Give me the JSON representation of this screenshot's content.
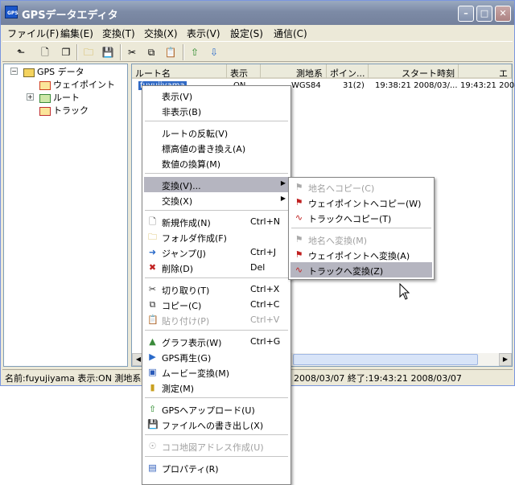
{
  "window": {
    "title": "GPSデータエディタ",
    "icon_text": "GPS"
  },
  "title_buttons": [
    "minimize-icon",
    "maximize-icon",
    "close-icon"
  ],
  "menubar": [
    "ファイル(F)",
    "編集(E)",
    "変換(T)",
    "交換(X)",
    "表示(V)",
    "設定(S)",
    "通信(C)"
  ],
  "toolbar": [
    "up-folder-icon",
    "new-file-icon",
    "copy-file-icon",
    "open-folder-icon",
    "save-icon",
    "cut-icon",
    "copy-icon",
    "paste-icon",
    "upload-icon",
    "download-icon"
  ],
  "tree": {
    "root": "GPS データ",
    "items": [
      "ウェイポイント",
      "ルート",
      "トラック"
    ],
    "colors": {
      "waypoint": "#d04020",
      "route": "#3a8a3a",
      "track": "#c03030",
      "folder": "#f4d35e"
    }
  },
  "list": {
    "columns": [
      "ルート名",
      "表示",
      "測地系",
      "ポイン...",
      "スタート時刻",
      "エ"
    ],
    "row": {
      "name": "fuyujiyama",
      "display": "ON",
      "datum": "WGS84",
      "points": "31(2)",
      "start": "19:38:21 2008/03/...",
      "end": "19:43:21 2008/03/"
    }
  },
  "status": {
    "left": "名前:fuyujiyama 表示:ON 測地系:W",
    "right": "2008/03/07 終了:19:43:21 2008/03/07"
  },
  "context_menu": {
    "items": [
      {
        "label": "表示(V)"
      },
      {
        "label": "非表示(B)"
      },
      {
        "sep": true
      },
      {
        "label": "ルートの反転(V)"
      },
      {
        "label": "標高値の書き換え(A)"
      },
      {
        "label": "数値の換算(M)"
      },
      {
        "sep": true
      },
      {
        "label": "変換(V)...",
        "submenu": true,
        "highlighted": true
      },
      {
        "label": "交換(X)",
        "submenu": true
      },
      {
        "sep": true
      },
      {
        "label": "新規作成(N)",
        "shortcut": "Ctrl+N",
        "icon": "new-file-icon"
      },
      {
        "label": "フォルダ作成(F)",
        "icon": "folder-icon"
      },
      {
        "label": "ジャンプ(J)",
        "shortcut": "Ctrl+J",
        "icon": "jump-icon"
      },
      {
        "label": "削除(D)",
        "shortcut": "Del",
        "icon": "delete-icon"
      },
      {
        "sep": true
      },
      {
        "label": "切り取り(T)",
        "shortcut": "Ctrl+X",
        "icon": "cut-icon"
      },
      {
        "label": "コピー(C)",
        "shortcut": "Ctrl+C",
        "icon": "copy-icon"
      },
      {
        "label": "貼り付け(P)",
        "shortcut": "Ctrl+V",
        "icon": "paste-icon",
        "disabled": true
      },
      {
        "sep": true
      },
      {
        "label": "グラフ表示(W)",
        "shortcut": "Ctrl+G",
        "icon": "graph-icon"
      },
      {
        "label": "GPS再生(G)",
        "icon": "gps-play-icon"
      },
      {
        "label": "ムービー変換(M)",
        "icon": "movie-icon"
      },
      {
        "label": "測定(M)",
        "icon": "ruler-icon"
      },
      {
        "sep": true
      },
      {
        "label": "GPSへアップロード(U)",
        "icon": "upload-icon"
      },
      {
        "label": "ファイルへの書き出し(X)",
        "icon": "save-icon"
      },
      {
        "sep": true
      },
      {
        "label": "ココ地図アドレス作成(U)",
        "icon": "map-address-icon",
        "disabled": true
      },
      {
        "sep": true
      },
      {
        "label": "プロパティ(R)",
        "icon": "properties-icon"
      }
    ]
  },
  "submenu": {
    "items": [
      {
        "label": "地名へコピー(C)",
        "icon": "place-copy-icon",
        "disabled": true
      },
      {
        "label": "ウェイポイントへコピー(W)",
        "icon": "waypoint-copy-icon"
      },
      {
        "label": "トラックへコピー(T)",
        "icon": "track-copy-icon"
      },
      {
        "sep": true
      },
      {
        "label": "地名へ変換(M)",
        "icon": "place-convert-icon",
        "disabled": true
      },
      {
        "label": "ウェイポイントへ変換(A)",
        "icon": "waypoint-convert-icon"
      },
      {
        "label": "トラックへ変換(Z)",
        "icon": "track-convert-icon",
        "highlighted": true
      }
    ]
  },
  "colors": {
    "highlight": "#b5b5c0",
    "titlebar": "#7d8ba6",
    "disabled_text": "#a0a0a0"
  }
}
